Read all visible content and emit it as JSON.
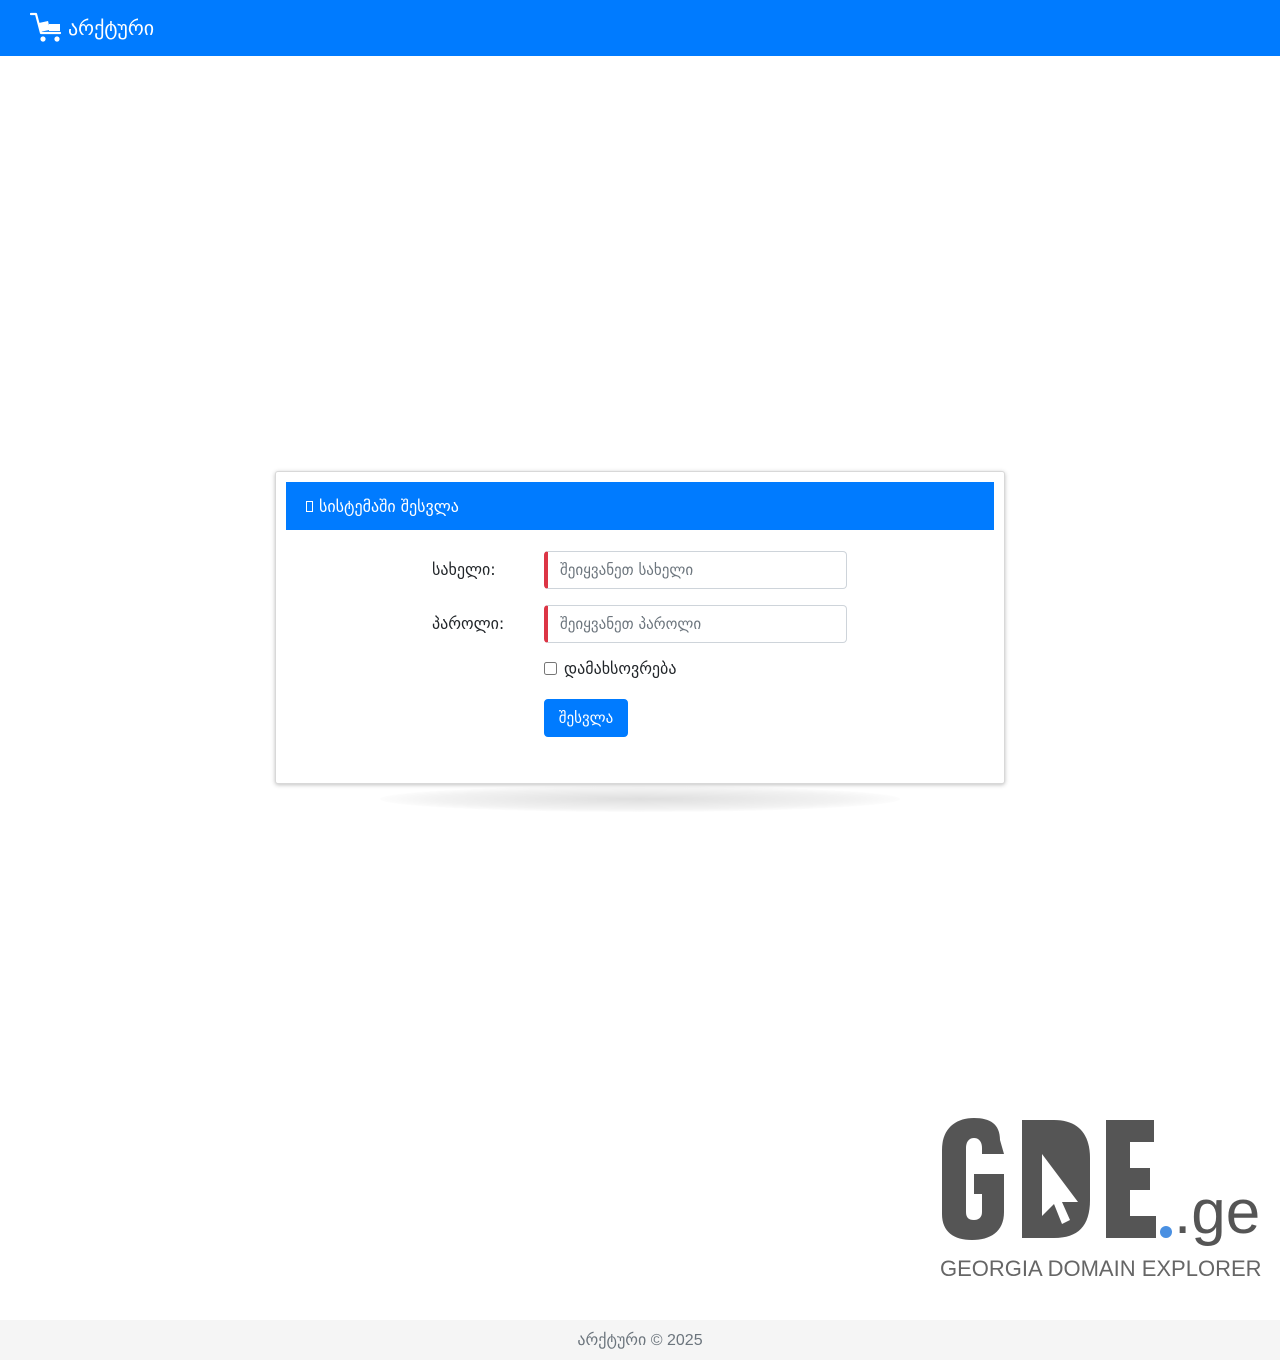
{
  "navbar": {
    "brand_label": "არქტური",
    "brand_icon": "cart-icon"
  },
  "login_card": {
    "title": "სისტემაში შესვლა",
    "title_icon": "sign-in-icon",
    "username": {
      "label": "სახელი:",
      "placeholder": "შეიყვანეთ სახელი",
      "value": ""
    },
    "password": {
      "label": "პაროლი:",
      "placeholder": "შეიყვანეთ პაროლი",
      "value": ""
    },
    "remember_label": "დამახსოვრება",
    "remember_checked": false,
    "submit_label": "შესვლა"
  },
  "watermark": {
    "logo_text": "GDE",
    "logo_suffix": ".ge",
    "logo_caption": "GEORGIA DOMAIN EXPLORER",
    "logo_color": "#555555",
    "dot_color": "#4a90e2"
  },
  "footer": {
    "text": "არქტური © 2025"
  },
  "colors": {
    "primary": "#007bff",
    "invalid_border": "#dc3545",
    "footer_bg": "#f5f5f5"
  }
}
